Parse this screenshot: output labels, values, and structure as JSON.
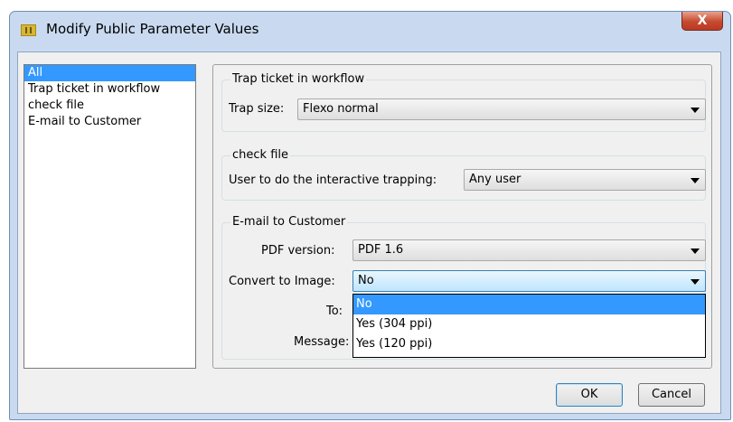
{
  "window": {
    "title": "Modify Public Parameter Values",
    "close_glyph": "X"
  },
  "sidebar": {
    "items": [
      {
        "label": "All",
        "selected": true
      },
      {
        "label": "Trap ticket in workflow",
        "selected": false
      },
      {
        "label": "check file",
        "selected": false
      },
      {
        "label": "E-mail to Customer",
        "selected": false
      }
    ]
  },
  "groups": {
    "trap": {
      "title": "Trap ticket in workflow",
      "trap_size_label": "Trap size:",
      "trap_size_value": "Flexo normal"
    },
    "check": {
      "title": "check file",
      "user_label": "User to do the interactive trapping:",
      "user_value": "Any user"
    },
    "email": {
      "title": "E-mail to Customer",
      "pdf_label": "PDF version:",
      "pdf_value": "PDF 1.6",
      "convert_label": "Convert to Image:",
      "convert_value": "No",
      "to_label": "To:",
      "message_label": "Message:"
    }
  },
  "dropdown": {
    "options": [
      {
        "label": "No",
        "selected": true
      },
      {
        "label": "Yes (304 ppi)",
        "selected": false
      },
      {
        "label": "Yes (120 ppi)",
        "selected": false
      }
    ]
  },
  "buttons": {
    "ok": "OK",
    "cancel": "Cancel"
  },
  "colors": {
    "selection": "#3399ff",
    "window_frame": "#c9daf0",
    "close_button": "#c64a30"
  }
}
